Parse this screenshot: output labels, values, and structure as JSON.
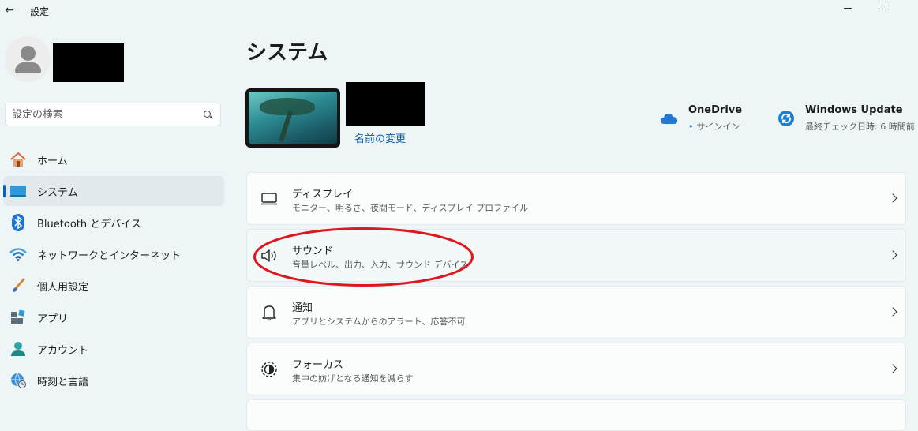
{
  "window": {
    "title": "設定"
  },
  "search": {
    "placeholder": "設定の検索"
  },
  "sidebar": {
    "items": [
      {
        "label": "ホーム",
        "icon": "home-icon",
        "active": false
      },
      {
        "label": "システム",
        "icon": "system-icon",
        "active": true
      },
      {
        "label": "Bluetooth とデバイス",
        "icon": "bluetooth-icon",
        "active": false
      },
      {
        "label": "ネットワークとインターネット",
        "icon": "wifi-icon",
        "active": false
      },
      {
        "label": "個人用設定",
        "icon": "brush-icon",
        "active": false
      },
      {
        "label": "アプリ",
        "icon": "apps-icon",
        "active": false
      },
      {
        "label": "アカウント",
        "icon": "account-icon",
        "active": false
      },
      {
        "label": "時刻と言語",
        "icon": "globe-clock-icon",
        "active": false
      }
    ]
  },
  "main": {
    "title": "システム",
    "rename_link": "名前の変更",
    "onedrive": {
      "title": "OneDrive",
      "status": "サインイン"
    },
    "windows_update": {
      "title": "Windows Update",
      "status": "最終チェック日時: 6 時間前"
    },
    "cards": [
      {
        "title": "ディスプレイ",
        "subtitle": "モニター、明るさ、夜間モード、ディスプレイ プロファイル",
        "icon": "display-icon"
      },
      {
        "title": "サウンド",
        "subtitle": "音量レベル、出力、入力、サウンド デバイス",
        "icon": "speaker-icon",
        "highlighted": true
      },
      {
        "title": "通知",
        "subtitle": "アプリとシステムからのアラート、応答不可",
        "icon": "bell-icon"
      },
      {
        "title": "フォーカス",
        "subtitle": "集中の妨げとなる通知を減らす",
        "icon": "focus-icon"
      }
    ]
  },
  "colors": {
    "accent": "#0067c0",
    "annotation": "#e0161f",
    "background": "#eef5f7"
  }
}
